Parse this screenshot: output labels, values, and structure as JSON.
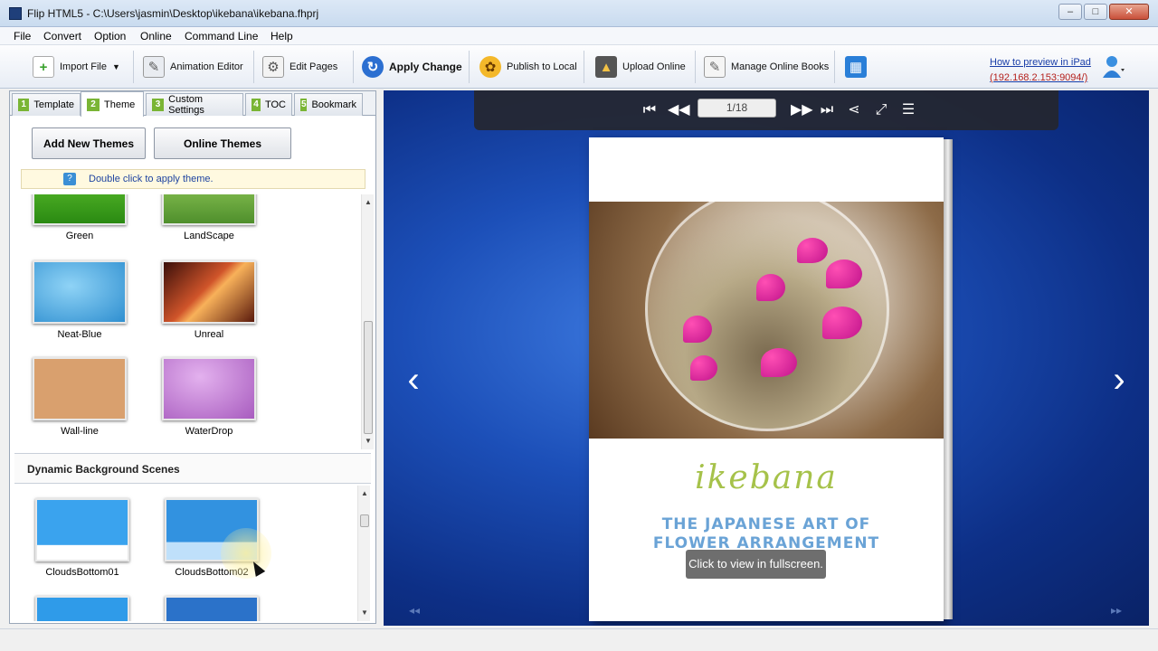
{
  "window": {
    "title": "Flip HTML5 - C:\\Users\\jasmin\\Desktop\\ikebana\\ikebana.fhprj",
    "controls": {
      "minimize": "–",
      "maximize": "□",
      "close": "✕"
    }
  },
  "menu": {
    "items": [
      "File",
      "Convert",
      "Option",
      "Online",
      "Command Line",
      "Help"
    ]
  },
  "toolbar": {
    "import_file": "Import File",
    "animation_editor": "Animation Editor",
    "edit_pages": "Edit Pages",
    "apply_change": "Apply Change",
    "publish_local": "Publish to Local",
    "upload_online": "Upload Online",
    "manage_books": "Manage Online Books",
    "preview_link": "How to preview in iPad",
    "preview_ip": "(192.168.2.153:9094/)"
  },
  "tabs": [
    {
      "num": "1",
      "label": "Template"
    },
    {
      "num": "2",
      "label": "Theme"
    },
    {
      "num": "3",
      "label": "Custom Settings"
    },
    {
      "num": "4",
      "label": "TOC"
    },
    {
      "num": "5",
      "label": "Bookmark"
    }
  ],
  "theme_panel": {
    "add_new_themes": "Add New Themes",
    "online_themes": "Online Themes",
    "hint_icon": "?",
    "hint": "Double click to apply theme.",
    "themes": [
      {
        "name": "Green",
        "color": "#3b9a1c"
      },
      {
        "name": "LandScape",
        "color": "#7bb64a"
      },
      {
        "name": "Neat-Blue",
        "color": "#3d9fd8"
      },
      {
        "name": "Unreal",
        "color": "#d0542a"
      },
      {
        "name": "Wall-line",
        "color": "#d9a06e"
      },
      {
        "name": "WaterDrop",
        "color": "#b46ac6"
      }
    ],
    "dynamic_heading": "Dynamic Background Scenes",
    "dynamic_scenes": [
      {
        "name": "CloudsBottom01",
        "color": "#3aa3ee"
      },
      {
        "name": "CloudsBottom02",
        "color": "#3292e0"
      },
      {
        "name": "",
        "color": "#2f9be9"
      },
      {
        "name": "",
        "color": "#2b72c9"
      }
    ]
  },
  "viewer": {
    "page_indicator": "1/18",
    "book_title": "ikebana",
    "book_subtitle_line1": "THE JAPANESE ART OF",
    "book_subtitle_line2": "FLOWER ARRANGEMENT",
    "tooltip": "Click to view in fullscreen.",
    "prev_arrow": "‹",
    "next_arrow": "›",
    "small_prev": "◂◂",
    "small_next": "▸▸"
  },
  "colors": {
    "tab_number_green": "#7ab535",
    "link_blue": "#1a3ea8",
    "link_ip_red": "#b5211d",
    "viewer_background": "#1c4fb8"
  }
}
